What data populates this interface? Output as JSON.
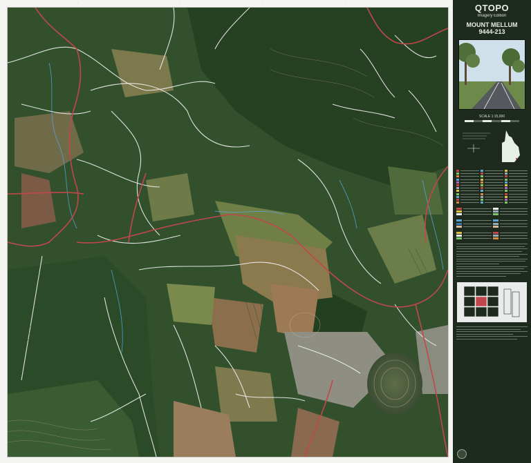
{
  "map": {
    "brand": "QTOPO",
    "edition": "Imagery Edition",
    "sheet_name": "MOUNT MELLUM",
    "sheet_number": "9444-213",
    "scale": "SCALE 1:15,000"
  },
  "colors": {
    "panel_bg": "#1f2a1f",
    "forest": "#2f4a2a",
    "road_major": "#c2474c",
    "road_minor": "#f2f2f2",
    "contour": "#d9b8a0",
    "stream": "#5aa7d8",
    "pasture": "#7a8f4a"
  },
  "icons": {
    "locator": "queensland-locator-map",
    "logo": "government-crest-icon"
  }
}
